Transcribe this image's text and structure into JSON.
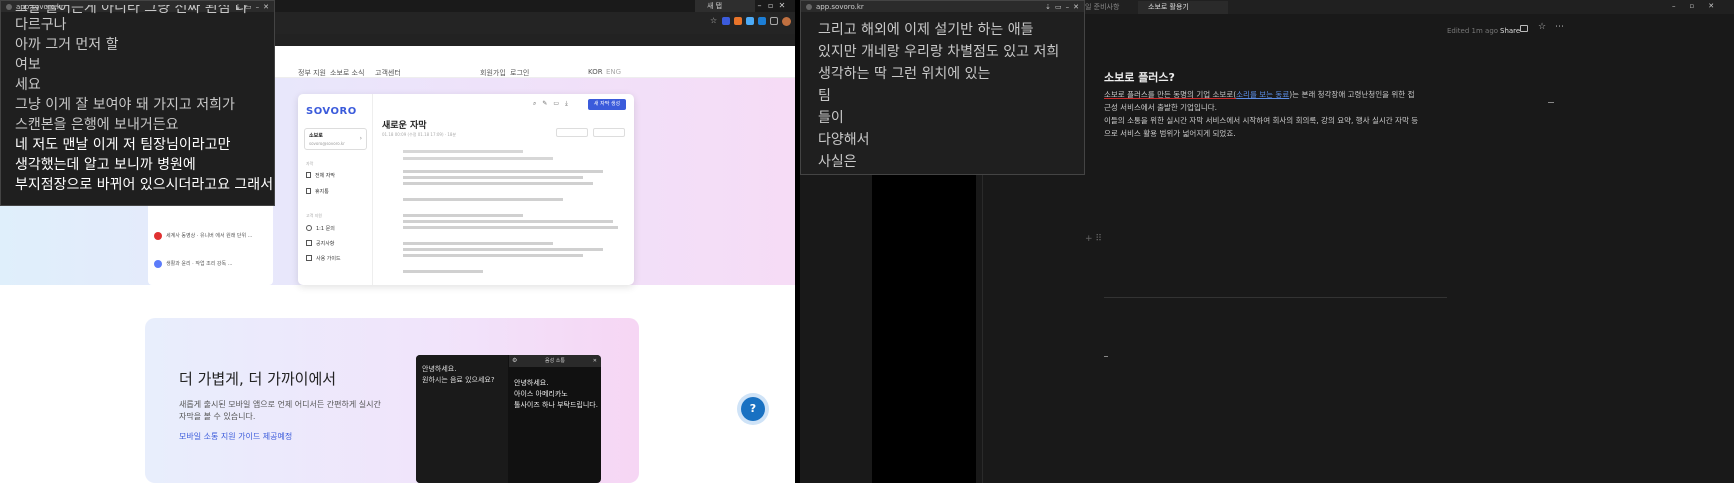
{
  "left_overlay": {
    "url": "app.sovoro.kr",
    "lines": [
      "그날 들어는게 아니라 그냥 전짜 된심 나",
      "다르구나",
      "아까 그거 먼저 할",
      "여보",
      "세요",
      "그냥 이게 잘 보여야 돼 가지고 저희가",
      "스캔본을 은행에 보내거든요",
      "네 저도 맨날 이게 저 팀장님이라고만",
      "생각했는데 알고 보니까 병원에",
      "부지점장으로 바뀌어 있으시더라고요 그래서"
    ]
  },
  "browser_left": {
    "tab_label": "새 탭",
    "nav": [
      "정부 지원",
      "소보로 소식",
      "고객센터",
      "회원가입",
      "로그인",
      "KOR",
      "ENG"
    ],
    "app_logo": "SOVORO",
    "doc_title": "새로운 자막",
    "doc_meta": "01.18 00:09 (수정 01.18 17:09)  ·  18분",
    "primary_btn": "새 자막 생성",
    "profile_name": "소보로",
    "profile_email": "sovoro@sovoro.kr",
    "side_section1": "자막",
    "side_items1": [
      "전체 자막",
      "휴지통"
    ],
    "side_section2": "고객 지원",
    "side_items2": [
      "1:1 문의",
      "공지사항",
      "사용 가이드"
    ],
    "hero_title": "더 가볍게, 더 가까이에서",
    "hero_desc1": "새롭게 출시된 모바일 앱으로 언제 어디서든 간편하게 실시간",
    "hero_desc2": "자막을 볼 수 있습니다.",
    "hero_link": "모바일 소통 지원 가이드 제공예정",
    "dialog_left1": "안녕하세요.",
    "dialog_left2": "원하시는 음료 있으세요?",
    "dialog_header": "음성 소통",
    "dialog_right": [
      "안녕하세요.",
      "아이스 아메리카노",
      "톨사이즈 하나 부탁드립니다."
    ],
    "help_icon": "?"
  },
  "right_overlay": {
    "url": "app.sovoro.kr",
    "lines": [
      "그리고 해외에 이제 설기반 하는 애들",
      "있지만 개네랑 우리랑 차별점도 있고 저희",
      "생각하는 딱 그런 위치에 있는",
      "팀",
      "들이",
      "다양해서",
      "사실은"
    ]
  },
  "notion": {
    "tab1": "일 준비사항",
    "tab2": "소보로 활용기",
    "edited": "Edited 1m ago",
    "share": "Share",
    "heading": "소보로 플러스?",
    "para1_a": "소보로 플러스를 만든 동명의 기업 소보로(",
    "para1_link": "소리를 보는 동료",
    "para1_b": ")는 본래 청각장애 고령난청인을 위한 접",
    "para1_c": "근성 서비스에서 출발한 기업입니다.",
    "para2_a": "이들의 소통을 위한 실시간 자막 서비스에서 시작하여 회사의 회의록, 강의 요약, 행사 실시간 자막 등",
    "para2_b": "으로 서비스 활용 범위가 넓어지게 되었죠."
  },
  "colors": {
    "accent": "#3b5bdb",
    "overlay_bg": "#1f1f1f",
    "notion_bg": "#191919"
  }
}
